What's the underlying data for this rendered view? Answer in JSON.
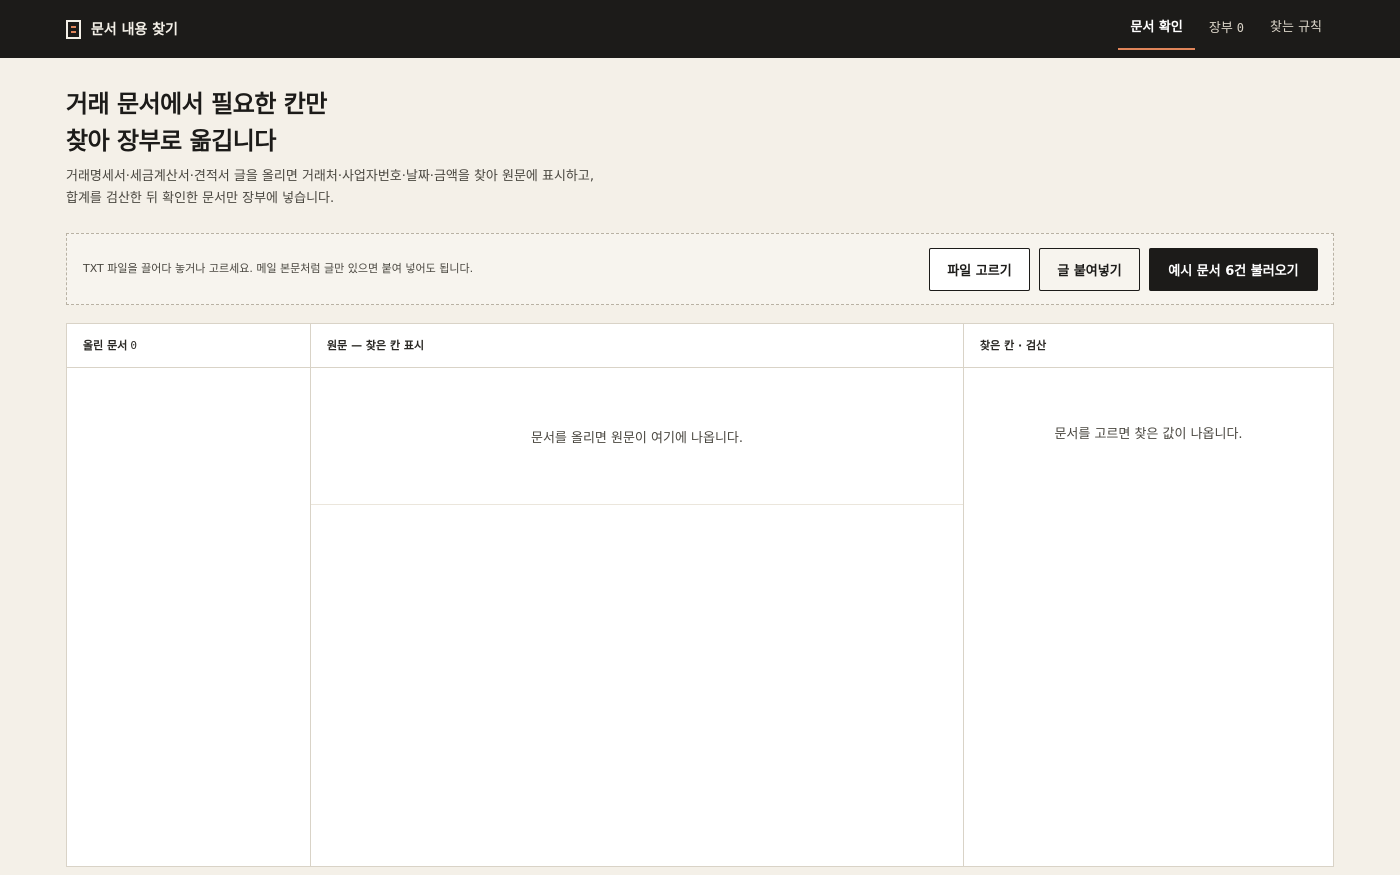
{
  "header": {
    "title": "문서 내용 찾기",
    "icon": "document-icon",
    "accent_color": "#e0855a",
    "nav": [
      {
        "label": "문서 확인",
        "active": true
      },
      {
        "label": "장부",
        "count": "0",
        "active": false
      },
      {
        "label": "찾는 규칙",
        "active": false
      }
    ]
  },
  "hero": {
    "headline_line1": "거래 문서에서 필요한 칸만",
    "headline_line2": "찾아 장부로 옮깁니다",
    "desc_line1": "거래명세서·세금계산서·견적서 글을 올리면 거래처·사업자번호·날짜·금액을 찾아 원문에 표시하고,",
    "desc_line2": "합계를 검산한 뒤 확인한 문서만 장부에 넣습니다."
  },
  "upload": {
    "hint": "TXT 파일을 끌어다 놓거나 고르세요. 메일 본문처럼 글만 있으면 붙여 넣어도 됩니다.",
    "file_button": "파일 고르기",
    "paste_button": "글 붙여넣기",
    "sample_button": "예시 문서 6건 불러오기"
  },
  "panels": {
    "docs": {
      "title": "올린 문서",
      "count": "0"
    },
    "source": {
      "title": "원문 — 찾은 칸 표시",
      "empty": "문서를 올리면 원문이 여기에 나옵니다."
    },
    "fields": {
      "title": "찾은 칸 · 검산",
      "empty": "문서를 고르면 찾은 값이 나옵니다."
    }
  }
}
